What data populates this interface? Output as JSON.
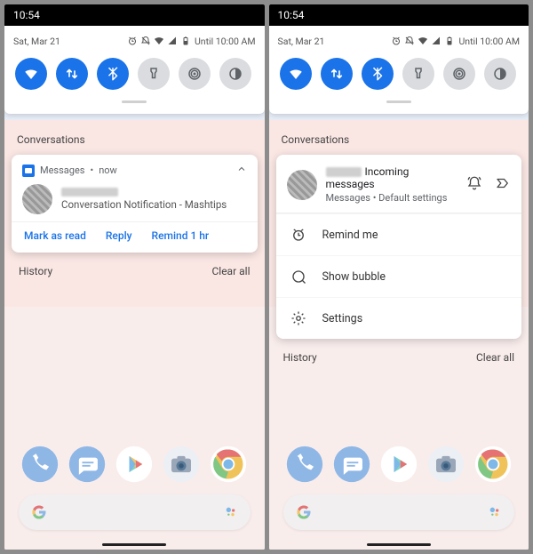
{
  "time": "10:54",
  "qs": {
    "date": "Sat, Mar 21",
    "until": "Until 10:00 AM",
    "tiles": [
      "wifi",
      "data",
      "bluetooth",
      "flashlight",
      "hotspot",
      "invert"
    ]
  },
  "sections": {
    "conversations": "Conversations",
    "history": "History",
    "clear_all": "Clear all"
  },
  "left_card": {
    "app": "Messages",
    "time": "now",
    "body": "Conversation Notification - Mashtips",
    "actions": {
      "mark_read": "Mark as read",
      "reply": "Reply",
      "remind": "Remind 1 hr"
    }
  },
  "right_card": {
    "title_suffix": "Incoming messages",
    "sub_app": "Messages",
    "sub_setting": "Default settings",
    "rows": {
      "remind": "Remind me",
      "bubble": "Show bubble",
      "settings": "Settings"
    }
  }
}
